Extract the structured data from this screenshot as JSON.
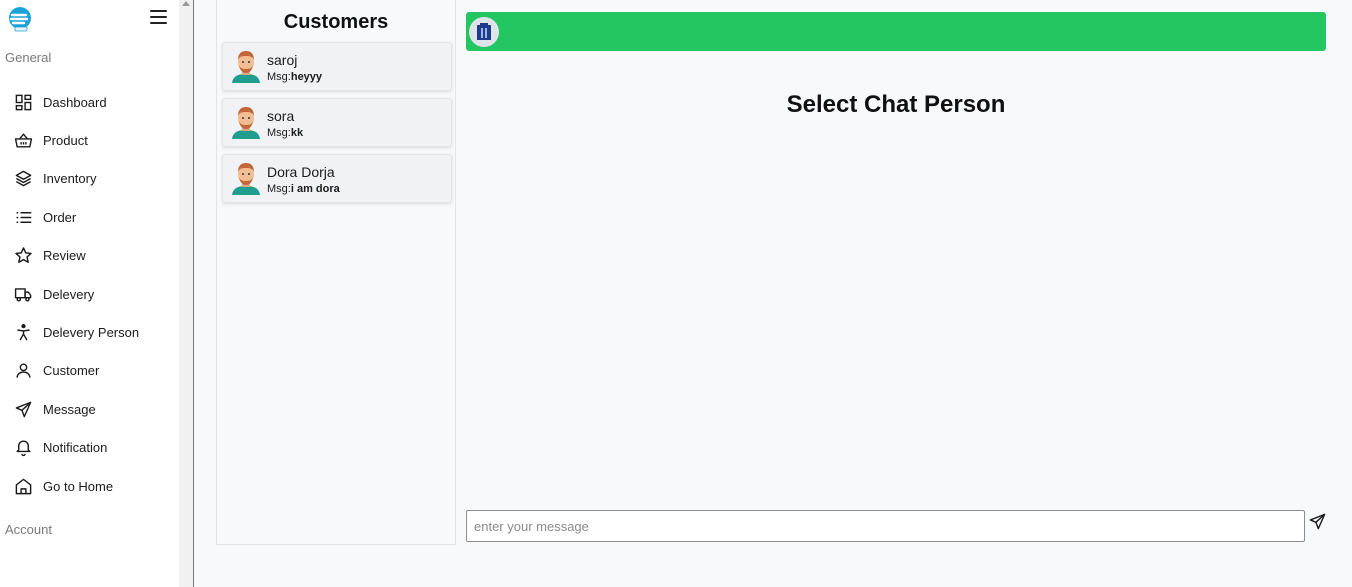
{
  "sidebar": {
    "section_general": "General",
    "section_account": "Account",
    "items": [
      {
        "label": "Dashboard",
        "icon": "dashboard-icon"
      },
      {
        "label": "Product",
        "icon": "basket-icon"
      },
      {
        "label": "Inventory",
        "icon": "layers-icon"
      },
      {
        "label": "Order",
        "icon": "list-icon"
      },
      {
        "label": "Review",
        "icon": "star-icon"
      },
      {
        "label": "Delevery",
        "icon": "truck-icon"
      },
      {
        "label": "Delevery Person",
        "icon": "person-icon"
      },
      {
        "label": "Customer",
        "icon": "user-icon"
      },
      {
        "label": "Message",
        "icon": "send-icon"
      },
      {
        "label": "Notification",
        "icon": "bell-icon"
      },
      {
        "label": "Go to Home",
        "icon": "home-icon"
      }
    ]
  },
  "customers": {
    "title": "Customers",
    "list": [
      {
        "name": "saroj",
        "msg_prefix": "Msg:",
        "msg": "heyyy"
      },
      {
        "name": "sora",
        "msg_prefix": "Msg:",
        "msg": "kk"
      },
      {
        "name": "Dora Dorja",
        "msg_prefix": "Msg:",
        "msg": "i am dora"
      }
    ]
  },
  "chat": {
    "header_color": "#23c660",
    "placeholder_title": "Select Chat Person",
    "input_placeholder": "enter your message"
  }
}
